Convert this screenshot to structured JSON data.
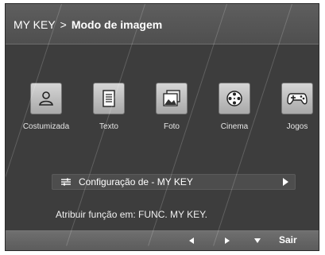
{
  "header": {
    "root": "MY KEY",
    "separator": ">",
    "page": "Modo de imagem"
  },
  "modes": [
    {
      "label": "Costumizada",
      "icon": "person-icon"
    },
    {
      "label": "Texto",
      "icon": "document-icon"
    },
    {
      "label": "Foto",
      "icon": "photo-icon"
    },
    {
      "label": "Cinema",
      "icon": "film-reel-icon"
    },
    {
      "label": "Jogos",
      "icon": "gamepad-icon"
    }
  ],
  "config": {
    "label": "Configuração de - MY KEY",
    "icon": "settings-sliders-icon"
  },
  "hint": "Atribuir função em: FUNC. MY KEY.",
  "footer": {
    "exit_label": "Sair"
  },
  "colors": {
    "background": "#3d3d3d",
    "header": "#555555",
    "tile": "#c8c8c8"
  }
}
